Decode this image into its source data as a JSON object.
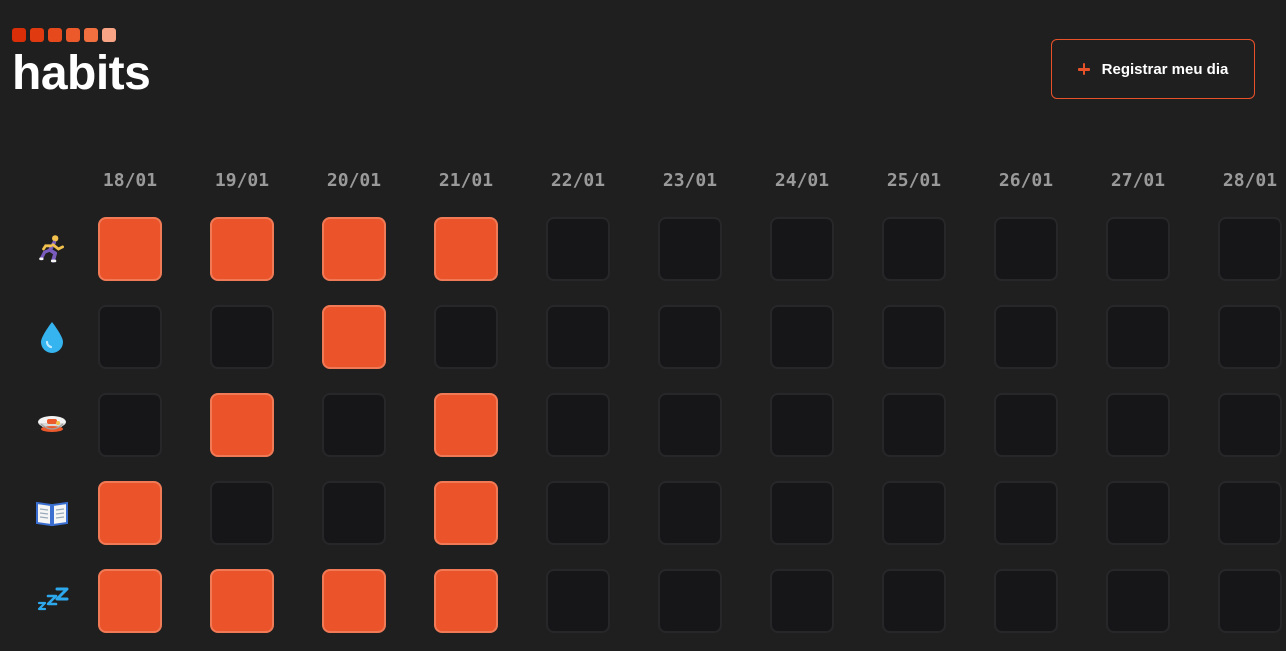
{
  "app": {
    "title": "habits",
    "logo_colors": [
      "#d92e08",
      "#e03a10",
      "#e64a1c",
      "#ec5a2c",
      "#f2703f",
      "#f9a585"
    ]
  },
  "header": {
    "register_button_label": "Registrar meu dia",
    "register_icon": "plus-icon"
  },
  "dates": [
    "18/01",
    "19/01",
    "20/01",
    "21/01",
    "22/01",
    "23/01",
    "24/01",
    "25/01",
    "26/01",
    "27/01",
    "28/01"
  ],
  "habits": [
    {
      "id": "running",
      "icon": "running-person-icon",
      "completed": [
        true,
        true,
        true,
        true,
        false,
        false,
        false,
        false,
        false,
        false,
        false
      ]
    },
    {
      "id": "water",
      "icon": "water-droplet-icon",
      "completed": [
        false,
        false,
        true,
        false,
        false,
        false,
        false,
        false,
        false,
        false,
        false
      ]
    },
    {
      "id": "meal",
      "icon": "food-bowl-icon",
      "completed": [
        false,
        true,
        false,
        true,
        false,
        false,
        false,
        false,
        false,
        false,
        false
      ]
    },
    {
      "id": "reading",
      "icon": "open-book-icon",
      "completed": [
        true,
        false,
        false,
        true,
        false,
        false,
        false,
        false,
        false,
        false,
        false
      ]
    },
    {
      "id": "sleep",
      "icon": "zzz-sleep-icon",
      "completed": [
        true,
        true,
        true,
        true,
        false,
        false,
        false,
        false,
        false,
        false,
        false
      ]
    }
  ],
  "colors": {
    "accent": "#eb532b",
    "accent_border": "#f07a55",
    "empty_cell": "#161618",
    "empty_cell_border": "#27272a",
    "background": "#1f1f1f",
    "date_text": "#9a9a9a"
  }
}
